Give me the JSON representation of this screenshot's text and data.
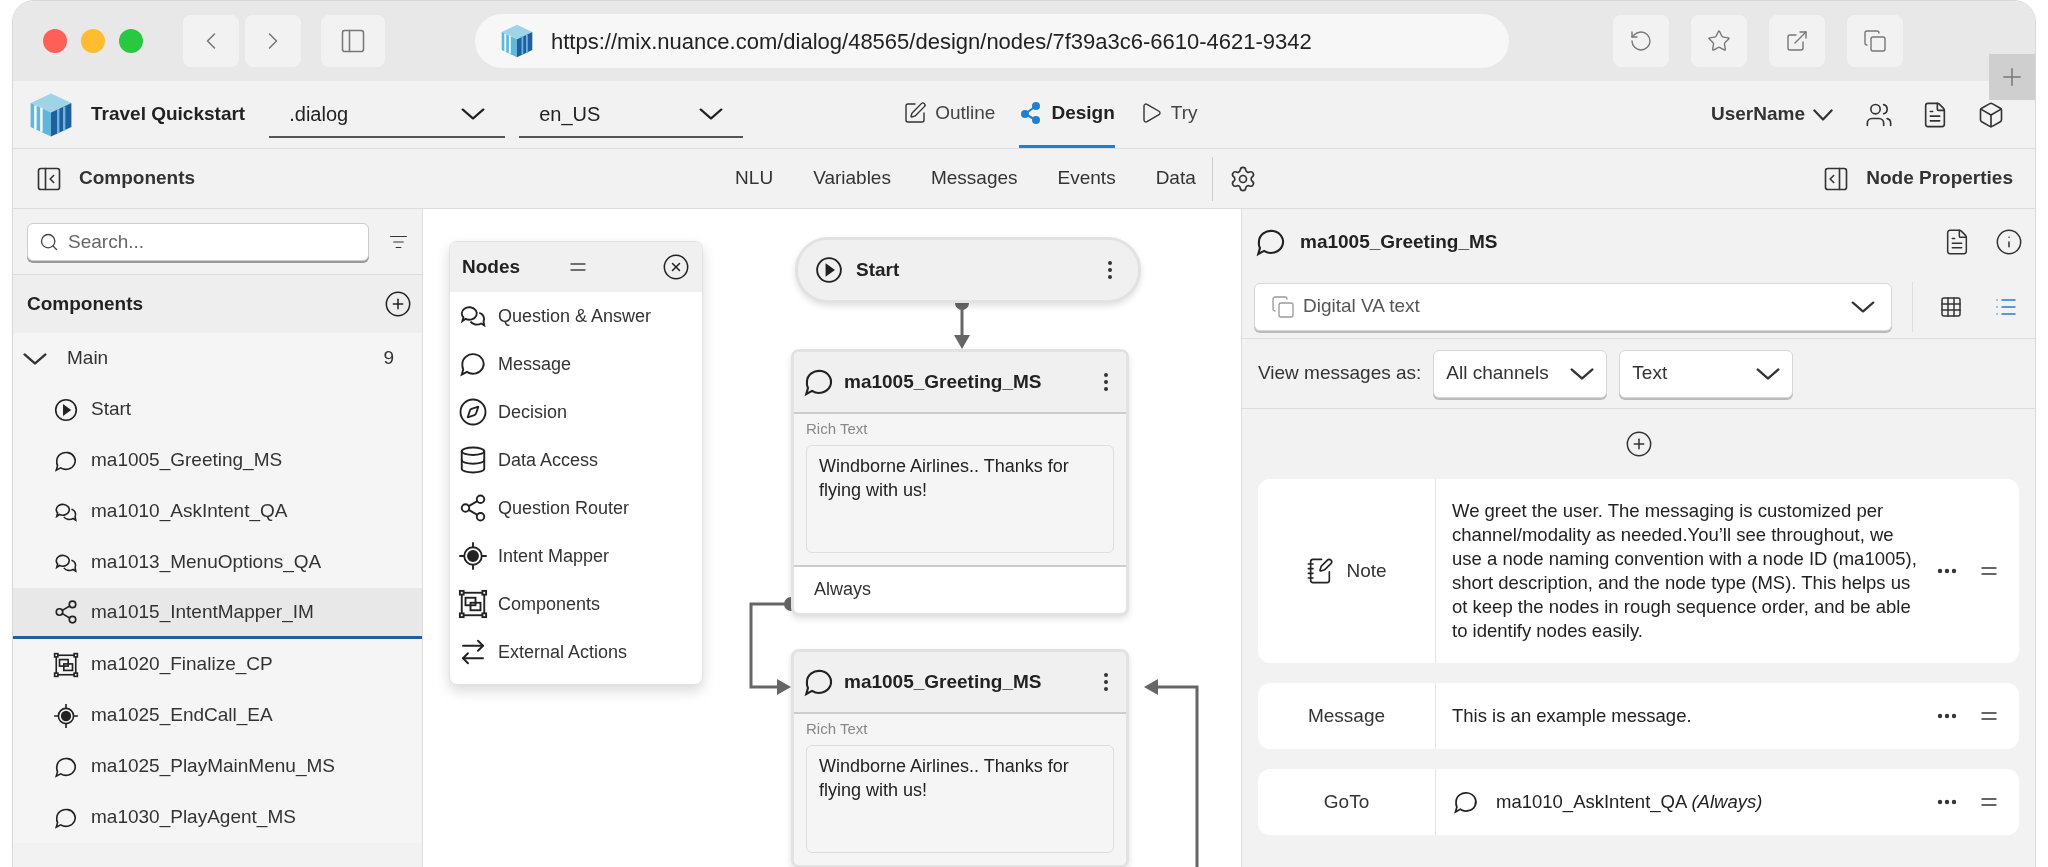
{
  "browser": {
    "url": "https://mix.nuance.com/dialog/48565/design/nodes/7f39a3c6-6610-4621-9342"
  },
  "app": {
    "project": "Travel Quickstart",
    "dialog_select": ".dialog",
    "locale_select": "en_US",
    "modes": [
      {
        "label": "Outline",
        "kind": "outline",
        "selected": false
      },
      {
        "label": "Design",
        "kind": "design",
        "selected": true
      },
      {
        "label": "Try",
        "kind": "try",
        "selected": false
      }
    ],
    "user": "UserName"
  },
  "nav": {
    "panel_title": "Components",
    "tabs": [
      "NLU",
      "Variables",
      "Messages",
      "Events",
      "Data"
    ],
    "right_panel": "Node Properties"
  },
  "sidebar": {
    "search_placeholder": "Search...",
    "header": "Components",
    "groups": [
      {
        "label": "Main",
        "count": "9",
        "expanded": true,
        "children": [
          {
            "label": "Start",
            "kind": "start",
            "selected": false
          },
          {
            "label": "ma1005_Greeting_MS",
            "kind": "message",
            "selected": false
          },
          {
            "label": "ma1010_AskIntent_QA",
            "kind": "qa",
            "selected": false
          },
          {
            "label": "ma1013_MenuOptions_QA",
            "kind": "qa",
            "selected": false
          },
          {
            "label": "ma1015_IntentMapper_IM",
            "kind": "router",
            "selected": true
          },
          {
            "label": "ma1020_Finalize_CP",
            "kind": "component",
            "selected": false
          },
          {
            "label": "ma1025_EndCall_EA",
            "kind": "mapper",
            "selected": false
          },
          {
            "label": "ma1025_PlayMainMenu_MS",
            "kind": "message",
            "selected": false
          },
          {
            "label": "ma1030_PlayAgent_MS",
            "kind": "message",
            "selected": false
          }
        ]
      }
    ]
  },
  "palette": {
    "title": "Nodes",
    "items": [
      {
        "label": "Question & Answer",
        "kind": "qa"
      },
      {
        "label": "Message",
        "kind": "message"
      },
      {
        "label": "Decision",
        "kind": "decision"
      },
      {
        "label": "Data Access",
        "kind": "data"
      },
      {
        "label": "Question Router",
        "kind": "router"
      },
      {
        "label": "Intent Mapper",
        "kind": "mapper"
      },
      {
        "label": "Components",
        "kind": "component"
      },
      {
        "label": "External Actions",
        "kind": "external"
      }
    ]
  },
  "canvas": {
    "nodes": [
      {
        "kind": "start",
        "title": "Start"
      },
      {
        "kind": "message",
        "title": "ma1005_Greeting_MS",
        "field_label": "Rich Text",
        "text": "Windborne Airlines.. Thanks for flying with us!",
        "transition": "Always"
      },
      {
        "kind": "message",
        "title": "ma1005_Greeting_MS",
        "field_label": "Rich Text",
        "text": "Windborne Airlines.. Thanks for flying with us!"
      }
    ]
  },
  "properties": {
    "title": "ma1005_Greeting_MS",
    "channel": "Digital VA text",
    "views": [
      {
        "kind": "table",
        "selected": false
      },
      {
        "kind": "list",
        "selected": true
      }
    ],
    "view_label": "View messages as:",
    "view_channel": "All channels",
    "view_format": "Text",
    "rows": [
      {
        "kind": "note",
        "label": "Note",
        "text": "We greet the user. The messaging is customized per channel/modality as needed.You’ll see throughout, we use a node naming convention with a node ID (ma1005), short description, and the node type (MS). This helps us ot keep the nodes in rough sequence order, and be able to identify nodes easily."
      },
      {
        "kind": "message",
        "label": "Message",
        "text": "This is an example message."
      },
      {
        "kind": "goto",
        "label": "GoTo",
        "text": "ma1010_AskIntent_QA *(Always)*"
      }
    ]
  }
}
